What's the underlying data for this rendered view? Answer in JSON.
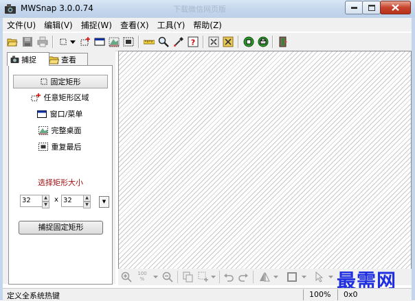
{
  "window": {
    "title": "MWSnap 3.0.0.74",
    "background_title": "下载微信网页版"
  },
  "menu": {
    "items": [
      "文件(U)",
      "编辑(V)",
      "捕捉(W)",
      "查看(X)",
      "工具(Y)",
      "帮助(Z)"
    ]
  },
  "toolbar": {
    "icons": [
      "open-icon",
      "save-icon",
      "print-icon",
      "fixed-rect-icon",
      "dropdown-arrow",
      "any-rect-icon",
      "window-icon",
      "desktop-icon",
      "repeat-icon",
      "ruler-icon",
      "magnifier-icon",
      "eyedropper-icon",
      "help-icon",
      "settings-icon",
      "hotkeys-icon",
      "record-icon",
      "stop-icon",
      "exit-icon"
    ]
  },
  "tabs": {
    "capture": "捕捉",
    "view": "查看"
  },
  "capture_options": {
    "fixed_rect": "固定矩形",
    "any_rect": "任意矩形区域",
    "window_menu": "窗口/菜单",
    "full_desktop": "完整桌面",
    "repeat_last": "重复最后"
  },
  "size": {
    "label": "选择矩形大小",
    "width": "32",
    "height": "32",
    "separator": "x"
  },
  "capture_button": "捕捉固定矩形",
  "bottom_toolbar": {
    "zoom_label": "100 %"
  },
  "status": {
    "hint": "定义全系统热键",
    "zoom": "100%",
    "size": "0x0"
  },
  "watermark": "最需网",
  "colors": {
    "title_gradient": "#c4d6ec",
    "close_button": "#c7432c",
    "size_label": "#a01010",
    "watermark": "#1f2fe0"
  }
}
